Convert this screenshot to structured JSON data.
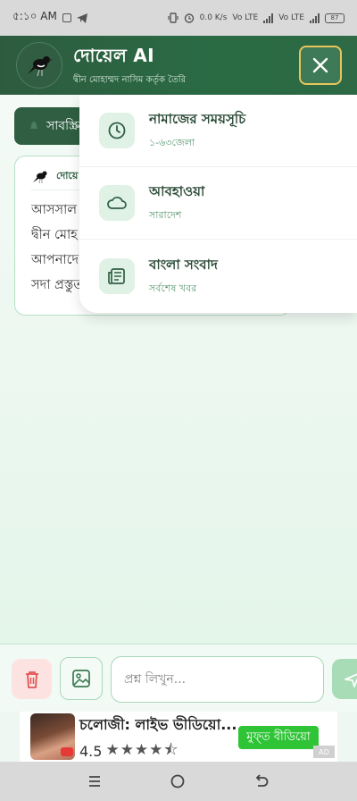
{
  "status_bar": {
    "time": "৫:১০ AM",
    "network_1": "Vo LTE",
    "network_2": "Vo LTE",
    "speed": "0.0 K/s",
    "battery": "87"
  },
  "header": {
    "title": "দোয়েল AI",
    "subtitle": "দ্বীন মোহাম্মদ নাসিম কর্তৃক তৈরি"
  },
  "chat": {
    "chip_label": "সাবস্ক্রি",
    "message_sender": "দোয়ে",
    "message_lines": [
      "আসসাল",
      "দ্বীন মোহ",
      "আপনাদে",
      "সদা প্রস্তুত"
    ]
  },
  "menu": {
    "items": [
      {
        "title": "নামাজের সময়সূচি",
        "subtitle": "১-৬৩জেলা",
        "icon": "clock-icon"
      },
      {
        "title": "আবহাওয়া",
        "subtitle": "সারাদেশ",
        "icon": "cloud-icon"
      },
      {
        "title": "বাংলা সংবাদ",
        "subtitle": "সর্বশেষ খবর",
        "icon": "newspaper-icon"
      }
    ]
  },
  "input": {
    "placeholder": "প্রশ্ন লিখুন..."
  },
  "ad": {
    "title": "চলোজী: লাইভ ভীডিয়ো...",
    "rating": "4.5",
    "cta": "মুফ্ত বীডিয়ো",
    "badge": "AD"
  },
  "colors": {
    "header": "#2d5b3e",
    "accent_border": "#e8c55a",
    "menu_icon_bg": "#e0f2e6",
    "delete_bg": "#fde2e2",
    "cta_green": "#2ec436"
  }
}
